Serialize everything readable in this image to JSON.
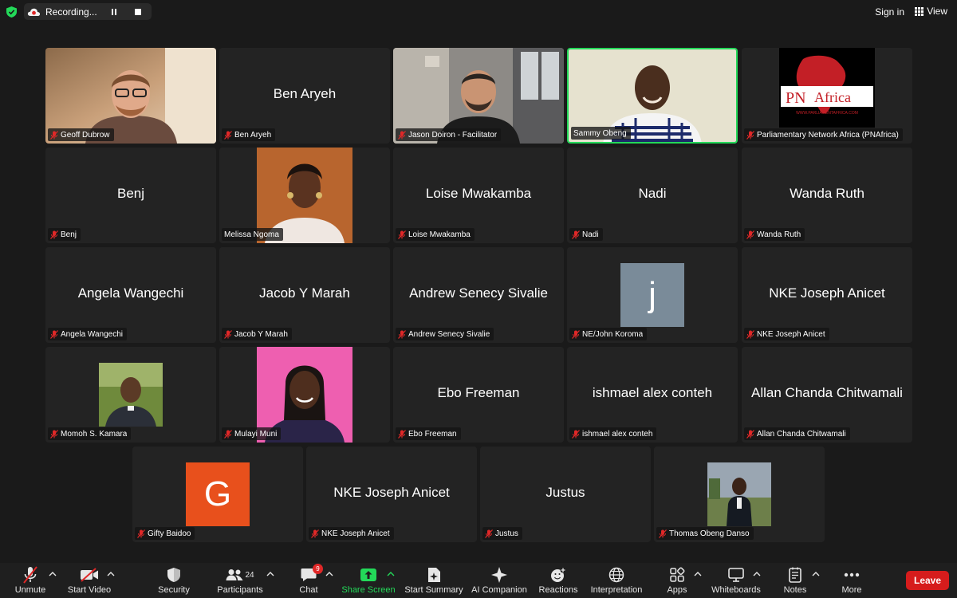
{
  "topbar": {
    "recording_label": "Recording...",
    "signin_label": "Sign in",
    "view_label": "View"
  },
  "tiles": [
    {
      "name": "Geoff Dubrow",
      "display": "",
      "type": "video"
    },
    {
      "name": "Ben Aryeh",
      "display": "Ben Aryeh",
      "type": "name"
    },
    {
      "name": "Jason Doiron - Facilitator",
      "display": "",
      "type": "video"
    },
    {
      "name": "Sammy Obeng",
      "display": "",
      "type": "video",
      "active": true
    },
    {
      "name": "Parliamentary Network Africa (PNAfrica)",
      "display": "",
      "type": "logo",
      "logo_text": "PN",
      "logo_text2": "Africa",
      "logo_url": "WWW.PARLIAMENTAFRICA.COM"
    },
    {
      "name": "Benj",
      "display": "Benj",
      "type": "name"
    },
    {
      "name": "Melissa Ngoma",
      "display": "",
      "type": "photo"
    },
    {
      "name": "Loise Mwakamba",
      "display": "Loise Mwakamba",
      "type": "name"
    },
    {
      "name": "Nadi",
      "display": "Nadi",
      "type": "name"
    },
    {
      "name": "Wanda Ruth",
      "display": "Wanda Ruth",
      "type": "name"
    },
    {
      "name": "Angela Wangechi",
      "display": "Angela Wangechi",
      "type": "name"
    },
    {
      "name": "Jacob Y Marah",
      "display": "Jacob Y Marah",
      "type": "name"
    },
    {
      "name": "Andrew Senecy Sivalie",
      "display": "Andrew Senecy Sivalie",
      "type": "name"
    },
    {
      "name": "NE/John Koroma",
      "display": "",
      "type": "letter",
      "letter": "j"
    },
    {
      "name": "NKE Joseph Anicet",
      "display": "NKE Joseph Anicet",
      "type": "name"
    },
    {
      "name": "Momoh S. Kamara",
      "display": "",
      "type": "photo"
    },
    {
      "name": "Mulayi Muni",
      "display": "",
      "type": "photo"
    },
    {
      "name": "Ebo Freeman",
      "display": "Ebo Freeman",
      "type": "name"
    },
    {
      "name": "ishmael alex conteh",
      "display": "ishmael alex conteh",
      "type": "name"
    },
    {
      "name": "Allan Chanda Chitwamali",
      "display": "Allan Chanda Chitwamali",
      "type": "name"
    },
    {
      "name": "Gifty Baidoo",
      "display": "",
      "type": "letter",
      "letter": "G"
    },
    {
      "name": "NKE Joseph Anicet",
      "display": "NKE Joseph Anicet",
      "type": "name"
    },
    {
      "name": "Justus",
      "display": "Justus",
      "type": "name"
    },
    {
      "name": "Thomas Obeng Danso",
      "display": "",
      "type": "photo"
    }
  ],
  "toolbar": {
    "unmute": "Unmute",
    "start_video": "Start Video",
    "security": "Security",
    "participants": "Participants",
    "participants_count": "24",
    "chat": "Chat",
    "chat_badge": "9",
    "share_screen": "Share Screen",
    "start_summary": "Start Summary",
    "ai_companion": "AI Companion",
    "reactions": "Reactions",
    "interpretation": "Interpretation",
    "apps": "Apps",
    "whiteboards": "Whiteboards",
    "notes": "Notes",
    "more": "More",
    "leave": "Leave"
  },
  "colors": {
    "active_speaker": "#23d959",
    "share_green": "#23d959",
    "leave_red": "#d61c1c",
    "mute_red": "#e02828",
    "tile_bg": "#232323"
  }
}
